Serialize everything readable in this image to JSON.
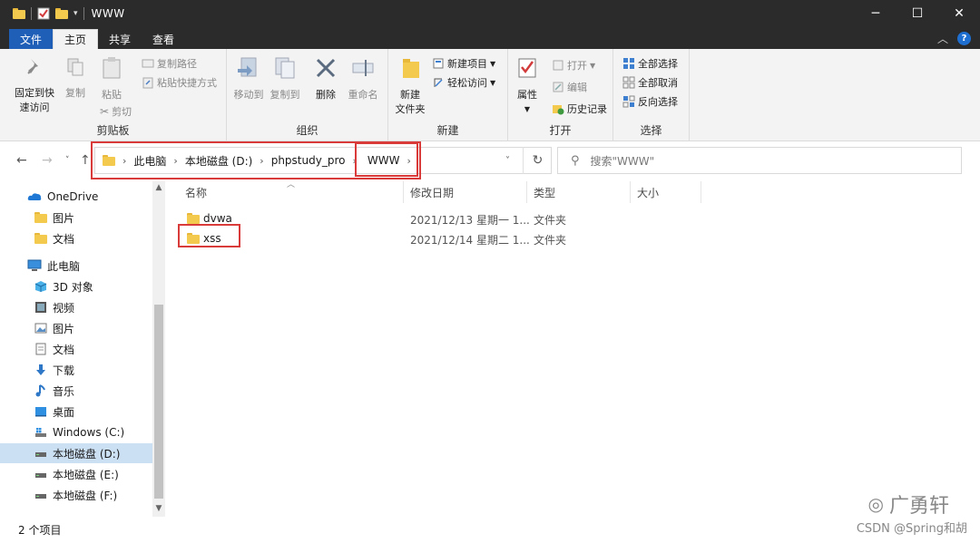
{
  "window": {
    "title": "WWW",
    "minimize": "─",
    "maximize": "☐",
    "close": "✕"
  },
  "tabs": {
    "file": "文件",
    "home": "主页",
    "share": "共享",
    "view": "查看"
  },
  "ribbon": {
    "clipboard": {
      "label": "剪贴板",
      "pin": "固定到快",
      "pin2": "速访问",
      "copy": "复制",
      "paste": "粘贴",
      "copy_path": "复制路径",
      "paste_shortcut": "粘贴快捷方式",
      "cut": "剪切"
    },
    "organize": {
      "label": "组织",
      "move_to": "移动到",
      "copy_to": "复制到",
      "delete": "删除",
      "rename": "重命名"
    },
    "new": {
      "label": "新建",
      "new_folder": "新建",
      "new_folder2": "文件夹",
      "new_item": "新建项目",
      "easy_access": "轻松访问"
    },
    "open": {
      "label": "打开",
      "properties": "属性",
      "open": "打开",
      "edit": "编辑",
      "history": "历史记录"
    },
    "select": {
      "label": "选择",
      "select_all": "全部选择",
      "select_none": "全部取消",
      "invert": "反向选择"
    }
  },
  "address": {
    "crumbs": [
      "此电脑",
      "本地磁盘 (D:)",
      "phpstudy_pro",
      "WWW"
    ],
    "search_placeholder": "搜索\"WWW\""
  },
  "nav": {
    "onedrive": "OneDrive",
    "od_pictures": "图片",
    "od_docs": "文档",
    "this_pc": "此电脑",
    "objects3d": "3D 对象",
    "videos": "视频",
    "pictures": "图片",
    "documents": "文档",
    "downloads": "下载",
    "music": "音乐",
    "desktop": "桌面",
    "drive_c": "Windows (C:)",
    "drive_d": "本地磁盘 (D:)",
    "drive_e": "本地磁盘 (E:)",
    "drive_f": "本地磁盘 (F:)"
  },
  "columns": {
    "name": "名称",
    "modified": "修改日期",
    "type": "类型",
    "size": "大小"
  },
  "files": [
    {
      "name": "dvwa",
      "modified": "2021/12/13 星期一 1...",
      "type": "文件夹"
    },
    {
      "name": "xss",
      "modified": "2021/12/14 星期二 1...",
      "type": "文件夹"
    }
  ],
  "status": {
    "count": "2 个项目"
  },
  "watermark": {
    "brand": "广勇轩",
    "csdn": "CSDN @Spring和胡"
  },
  "colors": {
    "titlebar": "#2b2b2b",
    "highlight_box": "#d93a3a",
    "selected_nav": "#cce0f4",
    "folder": "#f3c94e"
  }
}
